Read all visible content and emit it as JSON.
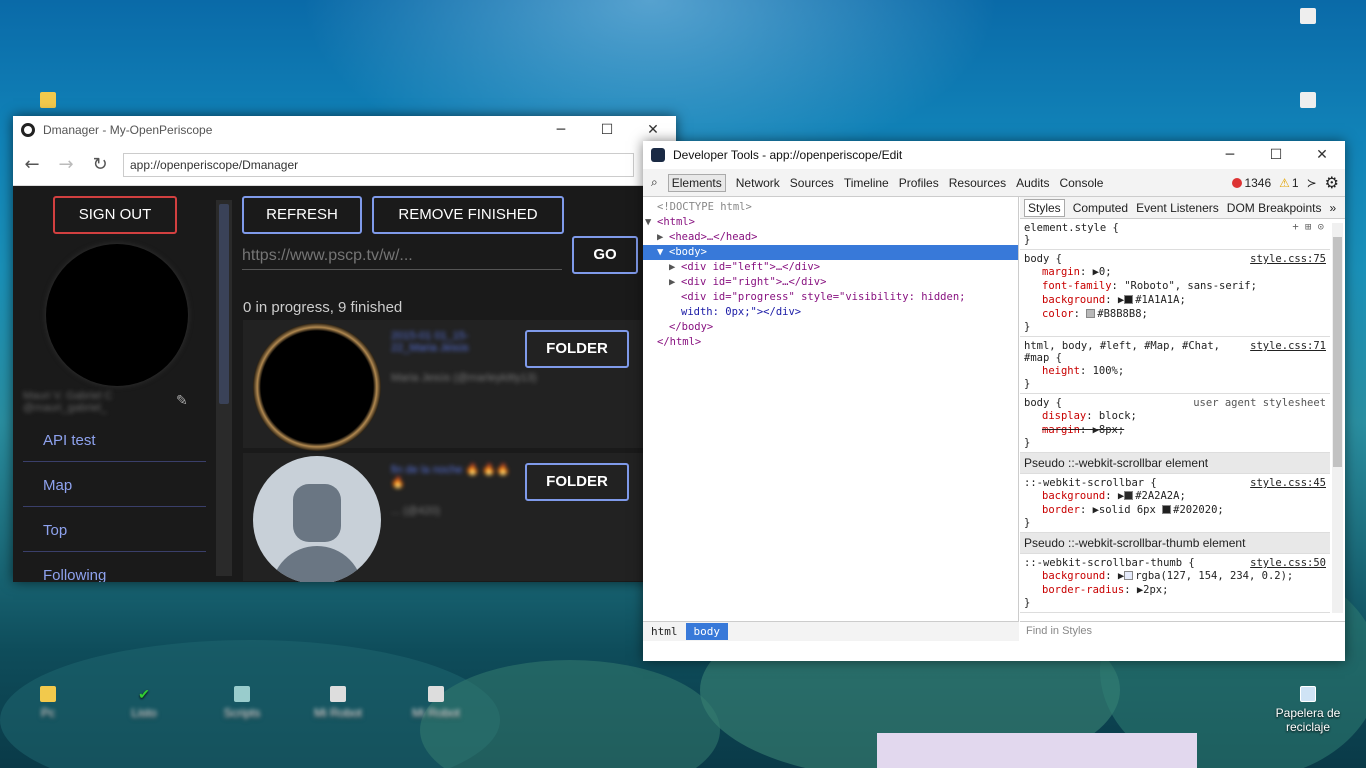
{
  "desktop": {
    "icons": [
      {
        "label": "Pc"
      },
      {
        "label": "Listo"
      },
      {
        "label": "Scripts"
      },
      {
        "label": "Mi Robot"
      },
      {
        "label": "Mi Robot"
      },
      {
        "label": "Papelera de reciclaje"
      }
    ]
  },
  "dmanager": {
    "title": "Dmanager - My-OpenPeriscope",
    "url": "app://openperiscope/Dmanager",
    "sign_out": "SIGN OUT",
    "username_line1": "Mauri V. Gabriel C",
    "username_line2": "@mauri_gabriel_",
    "menu": [
      "API test",
      "Map",
      "Top",
      "Following"
    ],
    "refresh": "REFRESH",
    "remove_finished": "REMOVE FINISHED",
    "url_placeholder": "https://www.pscp.tv/w/...",
    "go": "GO",
    "status": "0 in progress, 9 finished",
    "cards": [
      {
        "title": "2015-01 01_15-22_Maria Jesús",
        "subtitle": "Maria Jesús (@marleykitty13)",
        "folder": "FOLDER"
      },
      {
        "title": "fin de la noche 🔥 🔥🔥🔥",
        "subtitle": "... (@420)",
        "folder": "FOLDER"
      }
    ],
    "window_controls": {
      "min": "─",
      "max": "☐",
      "close": "✕"
    }
  },
  "devtools": {
    "title": "Developer Tools - app://openperiscope/Edit",
    "tabs": [
      "Elements",
      "Network",
      "Sources",
      "Timeline",
      "Profiles",
      "Resources",
      "Audits",
      "Console"
    ],
    "errors": "1346",
    "warnings": "1",
    "dom": {
      "doctype": "<!DOCTYPE html>",
      "html_open": "<html>",
      "head": "<head>…</head>",
      "body_open": "<body>",
      "div_left": "<div id=\"left\">…</div>",
      "div_right": "<div id=\"right\">…</div>",
      "div_progress_1": "<div id=\"progress\" style=\"visibility: hidden;",
      "div_progress_2": "width: 0px;\"></div>",
      "body_close": "</body>",
      "html_close": "</html>"
    },
    "breadcrumbs": [
      "html",
      "body"
    ],
    "style_tabs": [
      "Styles",
      "Computed",
      "Event Listeners",
      "DOM Breakpoints"
    ],
    "rules": {
      "element_style": "element.style {",
      "r1_sel": "body {",
      "r1_src": "style.css:75",
      "r1_d1_p": "margin",
      "r1_d1_v": "0;",
      "r1_d2_p": "font-family",
      "r1_d2_v": "\"Roboto\", sans-serif;",
      "r1_d3_p": "background",
      "r1_d3_v": "#1A1A1A;",
      "r1_d4_p": "color",
      "r1_d4_v": "#B8B8B8;",
      "r2_sel": "html, body, #left, #Map, #Chat, #map {",
      "r2_src": "style.css:71",
      "r2_d1_p": "height",
      "r2_d1_v": "100%;",
      "r3_sel": "body {",
      "r3_src": "user agent stylesheet",
      "r3_d1_p": "display",
      "r3_d1_v": "block;",
      "r3_d2_p": "margin",
      "r3_d2_v": "8px;",
      "pseudo1": "Pseudo ::-webkit-scrollbar element",
      "r4_sel": "::-webkit-scrollbar {",
      "r4_src": "style.css:45",
      "r4_d1_p": "background",
      "r4_d1_v": "#2A2A2A;",
      "r4_d2_p": "border",
      "r4_d2_v1": "solid 6px",
      "r4_d2_v2": "#202020;",
      "pseudo2": "Pseudo ::-webkit-scrollbar-thumb element",
      "r5_sel": "::-webkit-scrollbar-thumb {",
      "r5_src": "style.css:50",
      "r5_d1_p": "background",
      "r5_d1_v": "rgba(127, 154, 234, 0.2);",
      "r5_d2_p": "border-radius",
      "r5_d2_v": "2px;",
      "close": "}"
    },
    "find_placeholder": "Find in Styles"
  },
  "colors": {
    "accent": "#7f9aea",
    "signout": "#d24040",
    "selection": "#3879d9"
  }
}
